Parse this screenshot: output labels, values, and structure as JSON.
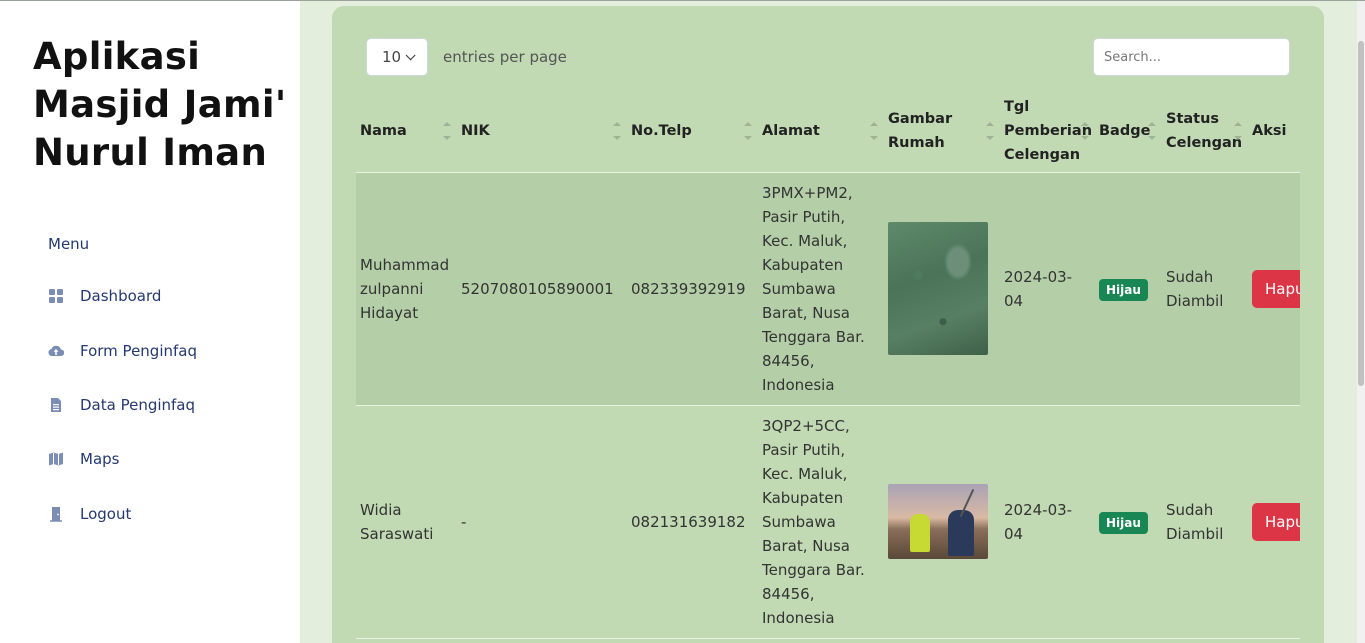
{
  "app": {
    "title": "Aplikasi Masjid Jami' Nurul Iman"
  },
  "sidebar": {
    "menu_label": "Menu",
    "items": [
      {
        "label": "Dashboard",
        "icon": "grid-icon"
      },
      {
        "label": "Form Penginfaq",
        "icon": "cloud-upload-icon"
      },
      {
        "label": "Data Penginfaq",
        "icon": "file-spreadsheet-icon"
      },
      {
        "label": "Maps",
        "icon": "map-icon"
      },
      {
        "label": "Logout",
        "icon": "door-icon"
      }
    ]
  },
  "table_controls": {
    "per_page_value": "10",
    "per_page_label": "entries per page",
    "search_placeholder": "Search..."
  },
  "table": {
    "headers": [
      "Nama",
      "NIK",
      "No.Telp",
      "Alamat",
      "Gambar Rumah",
      "Tgl Pemberian Celengan",
      "Badge",
      "Status Celengan",
      "Aksi"
    ],
    "rows": [
      {
        "nama": "Muhammad zulpanni Hidayat",
        "nik": "5207080105890001",
        "telp": "082339392919",
        "alamat": "3PMX+PM2, Pasir Putih, Kec. Maluk, Kabupaten Sumbawa Barat, Nusa Tenggara Bar. 84456, Indonesia",
        "image": "aerial-photo",
        "tgl": "2024-03-04",
        "badge": "Hijau",
        "status": "Sudah Diambil",
        "aksi": "Hapus"
      },
      {
        "nama": "Widia Saraswati",
        "nik": "-",
        "telp": "082131639182",
        "alamat": "3QP2+5CC, Pasir Putih, Kec. Maluk, Kabupaten Sumbawa Barat, Nusa Tenggara Bar. 84456, Indonesia",
        "image": "workers-photo",
        "tgl": "2024-03-04",
        "badge": "Hijau",
        "status": "Sudah Diambil",
        "aksi": "Hapus"
      }
    ]
  },
  "colors": {
    "card_bg": "#c1dab3",
    "page_bg": "#e3efdc",
    "badge_green": "#198754",
    "danger": "#dc3545",
    "nav_text": "#25396f"
  }
}
